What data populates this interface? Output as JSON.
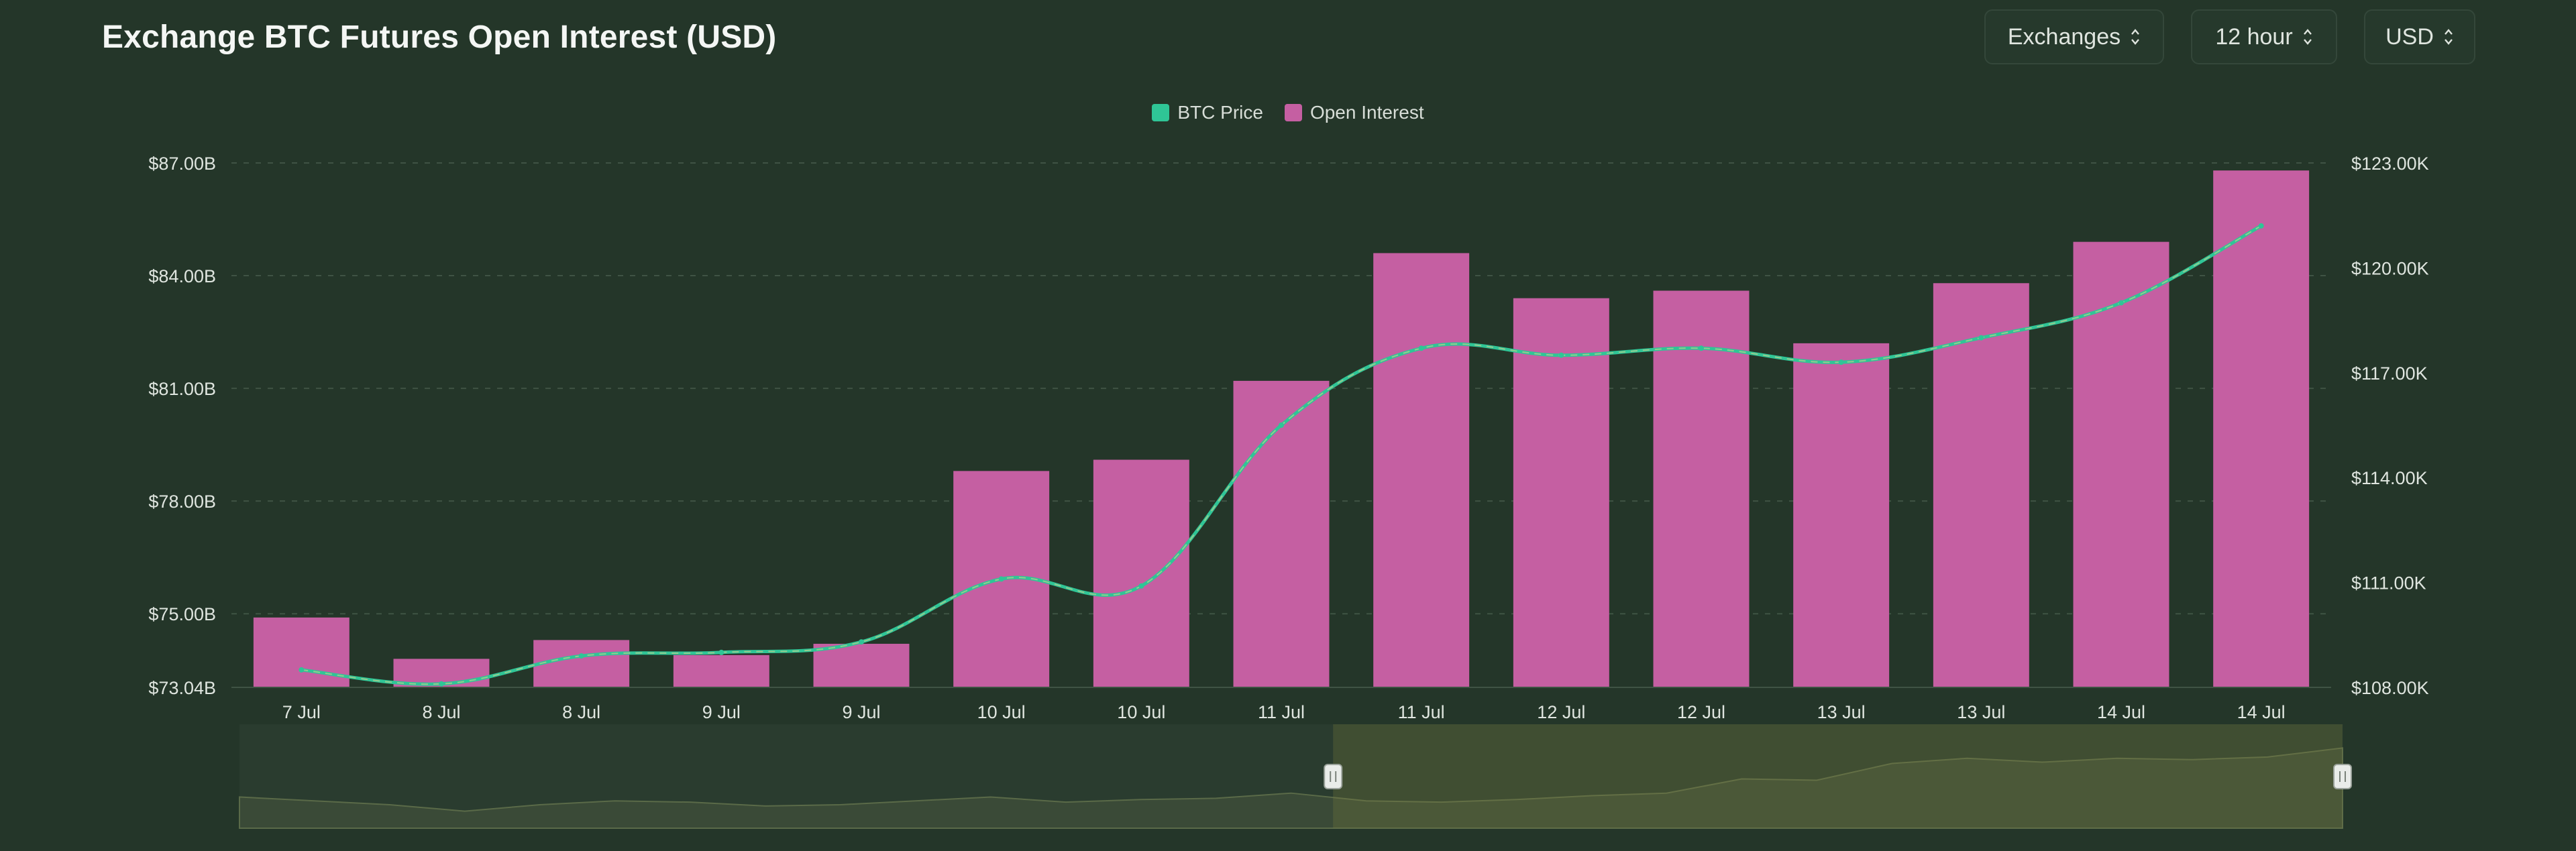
{
  "header": {
    "title": "Exchange BTC Futures Open Interest (USD)",
    "controls": [
      {
        "label": "Exchanges",
        "icon": "updown-icon"
      },
      {
        "label": "12 hour",
        "icon": "updown-icon"
      },
      {
        "label": "USD",
        "icon": "updown-icon"
      }
    ]
  },
  "colors": {
    "background": "#243629",
    "open_interest": "#c55fa2",
    "btc_price": "#2fc596",
    "price_dash": "#a6cc8e",
    "grid": "#3f5344",
    "tick_text": "#dfe5df"
  },
  "chart_data": {
    "type": "bar",
    "title": "Exchange BTC Futures Open Interest (USD)",
    "legend_position": "top-center",
    "grid": true,
    "categories": [
      "7 Jul",
      "8 Jul",
      "8 Jul",
      "9 Jul",
      "9 Jul",
      "10 Jul",
      "10 Jul",
      "11 Jul",
      "11 Jul",
      "12 Jul",
      "12 Jul",
      "13 Jul",
      "13 Jul",
      "14 Jul",
      "14 Jul"
    ],
    "series": [
      {
        "name": "Open Interest",
        "type": "bar",
        "axis": "left",
        "values": [
          74.9,
          73.8,
          74.3,
          73.9,
          74.2,
          78.8,
          79.1,
          81.2,
          84.6,
          83.4,
          83.6,
          82.2,
          83.8,
          84.9,
          86.8
        ]
      },
      {
        "name": "BTC Price",
        "type": "line",
        "axis": "right",
        "values": [
          108.5,
          108.1,
          108.9,
          109.0,
          109.3,
          111.1,
          110.9,
          115.5,
          117.7,
          117.5,
          117.7,
          117.3,
          118.0,
          119.0,
          121.2
        ]
      }
    ],
    "y_left": {
      "ticks": [
        "$73.04B",
        "$75.00B",
        "$78.00B",
        "$81.00B",
        "$84.00B",
        "$87.00B"
      ],
      "tick_values": [
        73.04,
        75,
        78,
        81,
        84,
        87
      ],
      "ylim": [
        73.04,
        87
      ]
    },
    "y_right": {
      "ticks": [
        "$108.00K",
        "$111.00K",
        "$114.00K",
        "$117.00K",
        "$120.00K",
        "$123.00K"
      ],
      "tick_values": [
        108,
        111,
        114,
        117,
        120,
        123
      ],
      "ylim": [
        108,
        123
      ]
    },
    "navigator": {
      "overview_values": [
        74.9,
        74.6,
        74.3,
        73.8,
        74.3,
        74.6,
        74.5,
        74.2,
        74.3,
        74.6,
        74.9,
        74.5,
        74.7,
        74.8,
        75.2,
        74.6,
        74.5,
        74.7,
        75.0,
        75.2,
        76.3,
        76.2,
        77.5,
        77.9,
        77.6,
        77.9,
        77.8,
        78.0,
        78.7
      ],
      "selected_range_fraction": [
        0.52,
        1.0
      ]
    }
  }
}
